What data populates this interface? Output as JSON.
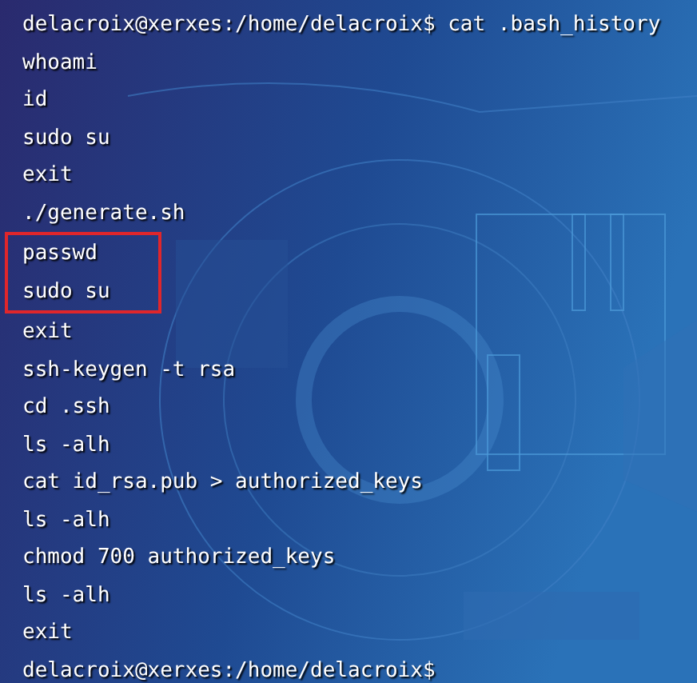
{
  "terminal": {
    "lines": [
      {
        "text": "delacroix@xerxes:/home/delacroix$ cat .bash_history",
        "highlighted": false
      },
      {
        "text": "whoami",
        "highlighted": false
      },
      {
        "text": "id",
        "highlighted": false
      },
      {
        "text": "sudo su",
        "highlighted": false
      },
      {
        "text": "exit",
        "highlighted": false
      },
      {
        "text": "./generate.sh",
        "highlighted": false
      },
      {
        "text": "passwd",
        "highlighted": true
      },
      {
        "text": "sudo su",
        "highlighted": true
      },
      {
        "text": "exit",
        "highlighted": false
      },
      {
        "text": "ssh-keygen -t rsa",
        "highlighted": false
      },
      {
        "text": "cd .ssh",
        "highlighted": false
      },
      {
        "text": "ls -alh",
        "highlighted": false
      },
      {
        "text": "cat id_rsa.pub > authorized_keys",
        "highlighted": false
      },
      {
        "text": "ls -alh",
        "highlighted": false
      },
      {
        "text": "chmod 700 authorized_keys",
        "highlighted": false
      },
      {
        "text": "ls -alh",
        "highlighted": false
      },
      {
        "text": "exit",
        "highlighted": false
      },
      {
        "text": "delacroix@xerxes:/home/delacroix$",
        "highlighted": false
      }
    ]
  }
}
